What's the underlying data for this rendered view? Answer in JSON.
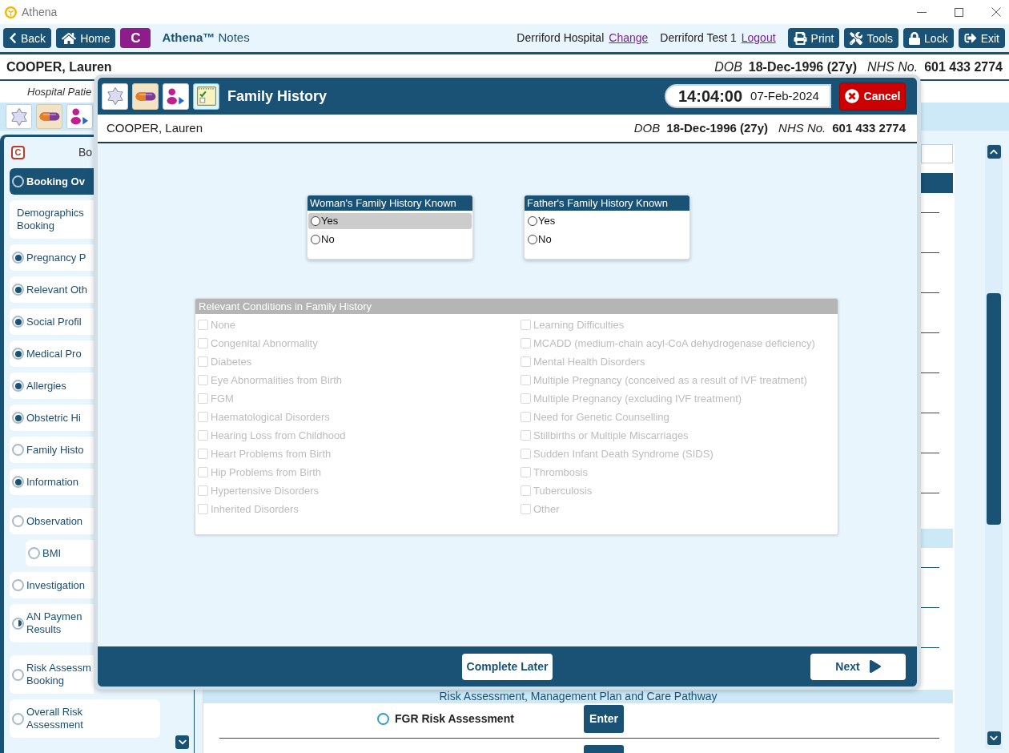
{
  "window": {
    "title": "Athena"
  },
  "toolbar": {
    "left_buttons": [
      {
        "kind": "back",
        "label": "Back"
      },
      {
        "kind": "home",
        "label": "Home"
      }
    ],
    "module_badge": "C",
    "app_title": "**Athena™** Notes",
    "location": "Derriford Hospital",
    "location_link": "Change",
    "user": "Derriford Test 1",
    "user_link": "Logout",
    "right_buttons": [
      {
        "kind": "print",
        "label": "Print"
      },
      {
        "kind": "tools",
        "label": "Tools"
      },
      {
        "kind": "lock",
        "label": "Lock"
      },
      {
        "kind": "exit",
        "label": "Exit"
      }
    ]
  },
  "patient_bar": {
    "name": "COOPER, Lauren",
    "dob_label": "DOB",
    "dob": "18-Dec-1996 (27y)",
    "nhs_label": "NHS No.",
    "nhs_number": "601 433 2774"
  },
  "subheader": {
    "text": "Hospital Patie"
  },
  "sidebar": {
    "badge": "C",
    "title": "Bo",
    "groups": [
      {
        "items": [
          {
            "kind": "task",
            "label": "Booking Ov",
            "started": false,
            "complete": false,
            "selected": true
          },
          {
            "kind": "plain",
            "label": "Demographics Booking",
            "selected": false
          },
          {
            "kind": "task",
            "label": "Pregnancy P",
            "started": true,
            "complete": true,
            "selected": false
          },
          {
            "kind": "task",
            "label": "Relevant Oth",
            "started": true,
            "complete": true,
            "selected": false
          },
          {
            "kind": "task",
            "label": "Social Profil",
            "started": true,
            "complete": true,
            "selected": false
          },
          {
            "kind": "task",
            "label": "Medical Pro",
            "started": true,
            "complete": true,
            "selected": false
          },
          {
            "kind": "task",
            "label": "Allergies",
            "started": true,
            "complete": true,
            "selected": false
          },
          {
            "kind": "task",
            "label": "Obstetric Hi",
            "started": true,
            "complete": true,
            "selected": false
          },
          {
            "kind": "task",
            "label": "Family Histo",
            "started": false,
            "complete": false,
            "selected": false
          },
          {
            "kind": "task",
            "label": "Information",
            "started": true,
            "complete": true,
            "selected": false
          }
        ]
      },
      {
        "items": [
          {
            "kind": "task",
            "label": "Observation",
            "started": false,
            "complete": false,
            "selected": false,
            "children": [
              {
                "kind": "task",
                "label": "BMI",
                "started": false,
                "complete": false,
                "selected": false
              }
            ]
          },
          {
            "kind": "task",
            "label": "Investigation",
            "started": false,
            "complete": false,
            "selected": false
          },
          {
            "kind": "task",
            "label": "AN Paymen Results",
            "started": true,
            "complete": false,
            "selected": false
          }
        ]
      },
      {
        "items": [
          {
            "kind": "task",
            "label": "Risk Assessm Booking",
            "started": false,
            "complete": false,
            "selected": false
          },
          {
            "kind": "task",
            "label": "Overall Risk Assessment",
            "started": false,
            "complete": false,
            "selected": false
          }
        ]
      }
    ]
  },
  "main_panel": {
    "section_title": "Risk Assessment, Management Plan and Care Pathway",
    "rows": [
      {
        "label": "FGR Risk Assessment",
        "started": false,
        "complete": false,
        "action": "Enter"
      }
    ]
  },
  "dialog": {
    "title": "Family History",
    "time": "14:04:00",
    "date": "07-Feb-2024",
    "cancel_label": "Cancel",
    "patient": {
      "name": "COOPER, Lauren",
      "dob_label": "DOB",
      "dob": "18-Dec-1996 (27y)",
      "nhs_label": "NHS No.",
      "nhs_number": "601 433 2774"
    },
    "questions": [
      {
        "title": "Woman's Family History Known",
        "options": [
          {
            "label": "Yes",
            "selected": false,
            "highlighted": true
          },
          {
            "label": "No",
            "selected": false,
            "highlighted": false
          }
        ]
      },
      {
        "title": "Father's Family History Known",
        "options": [
          {
            "label": "Yes",
            "selected": false,
            "highlighted": false
          },
          {
            "label": "No",
            "selected": false,
            "highlighted": false
          }
        ]
      }
    ],
    "conditions": {
      "title": "Relevant Conditions in Family History",
      "disabled": true,
      "columns": [
        {
          "items": [
            {
              "label": "None",
              "checked": false
            },
            {
              "label": "Congenital Abnormality",
              "checked": false
            },
            {
              "label": "Diabetes",
              "checked": false
            },
            {
              "label": "Eye Abnormalities from Birth",
              "checked": false
            },
            {
              "label": "FGM",
              "checked": false
            },
            {
              "label": "Haematological Disorders",
              "checked": false
            },
            {
              "label": "Hearing Loss from Childhood",
              "checked": false
            },
            {
              "label": "Heart Problems from Birth",
              "checked": false
            },
            {
              "label": "Hip Problems from Birth",
              "checked": false
            },
            {
              "label": "Hypertensive Disorders",
              "checked": false
            },
            {
              "label": "Inherited Disorders",
              "checked": false
            }
          ]
        },
        {
          "items": [
            {
              "label": "Learning Difficulties",
              "checked": false
            },
            {
              "label": "MCADD (medium-chain acyl-CoA dehydrogenase deficiency)",
              "checked": false
            },
            {
              "label": "Mental Health Disorders",
              "checked": false
            },
            {
              "label": "Multiple Pregnancy (conceived as a result of IVF treatment)",
              "checked": false
            },
            {
              "label": "Multiple Pregnancy (excluding IVF treatment)",
              "checked": false
            },
            {
              "label": "Need for Genetic Counselling",
              "checked": false
            },
            {
              "label": "Stillbirths or Multiple Miscarriages",
              "checked": false
            },
            {
              "label": "Sudden Infant Death Syndrome (SIDS)",
              "checked": false
            },
            {
              "label": "Thrombosis",
              "checked": false
            },
            {
              "label": "Tuberculosis",
              "checked": false
            },
            {
              "label": "Other",
              "checked": false
            }
          ]
        }
      ]
    },
    "footer": {
      "complete_later": "Complete Later",
      "next": "Next"
    }
  }
}
